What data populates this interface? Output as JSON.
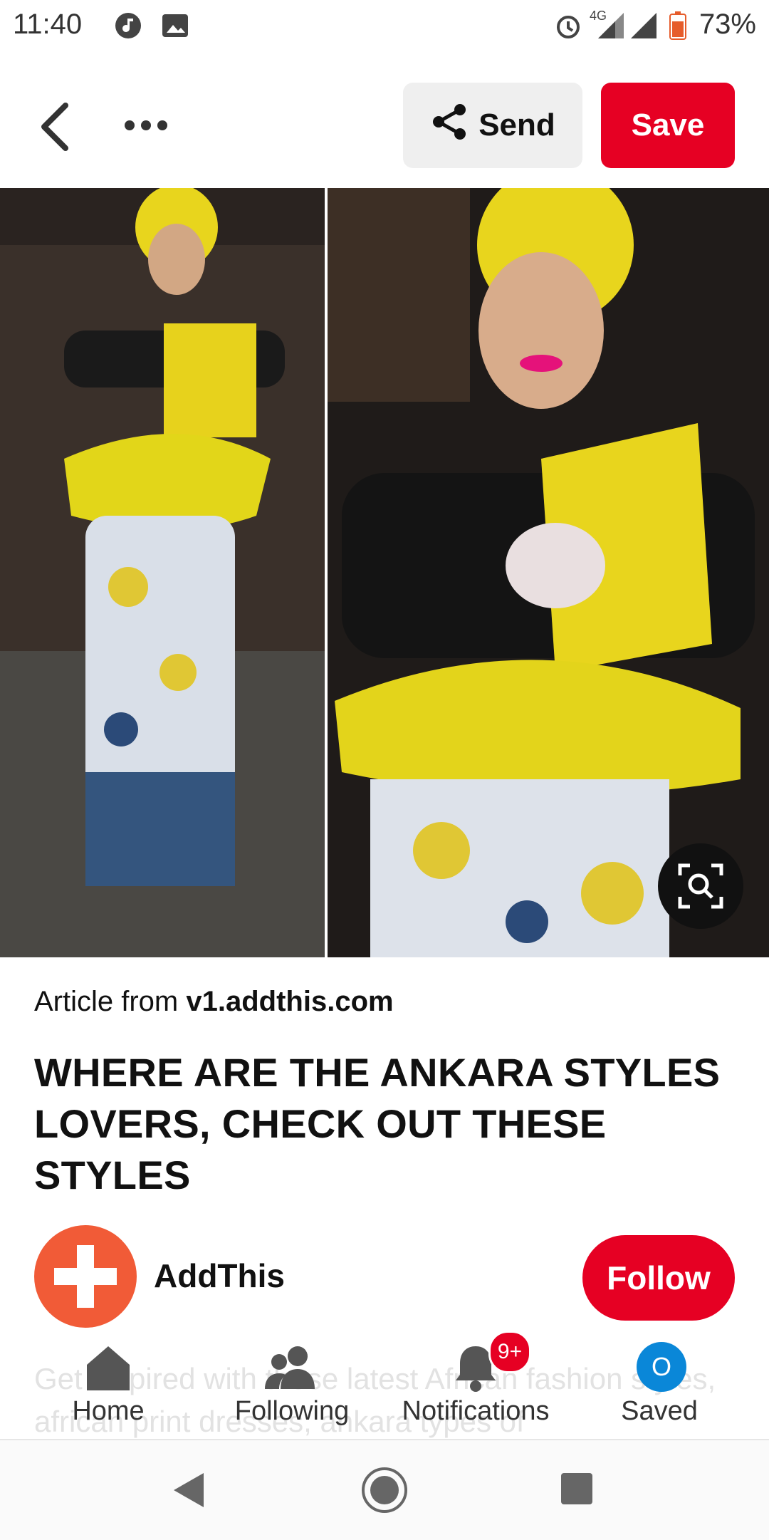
{
  "status_bar": {
    "time": "11:40",
    "battery": "73%",
    "network": "4G"
  },
  "top_bar": {
    "send_label": "Send",
    "save_label": "Save"
  },
  "pin": {
    "article_prefix": "Article from",
    "article_domain": "v1.addthis.com",
    "title": "WHERE ARE THE ANKARA STYLES LOVERS, CHECK OUT THESE STYLES",
    "description": "Get inspired with these latest African fashion styles, african print dresses, ankara types of"
  },
  "creator": {
    "name": "AddThis",
    "follow_label": "Follow",
    "avatar_color": "#f15b37"
  },
  "bottom_nav": {
    "items": [
      {
        "label": "Home",
        "icon": "home-icon"
      },
      {
        "label": "Following",
        "icon": "people-icon"
      },
      {
        "label": "Notifications",
        "icon": "bell-icon",
        "badge": "9+"
      },
      {
        "label": "Saved",
        "icon": "saved-avatar",
        "avatar_letter": "O"
      }
    ]
  },
  "colors": {
    "brand_red": "#e60023",
    "saved_blue": "#0a87d8"
  }
}
